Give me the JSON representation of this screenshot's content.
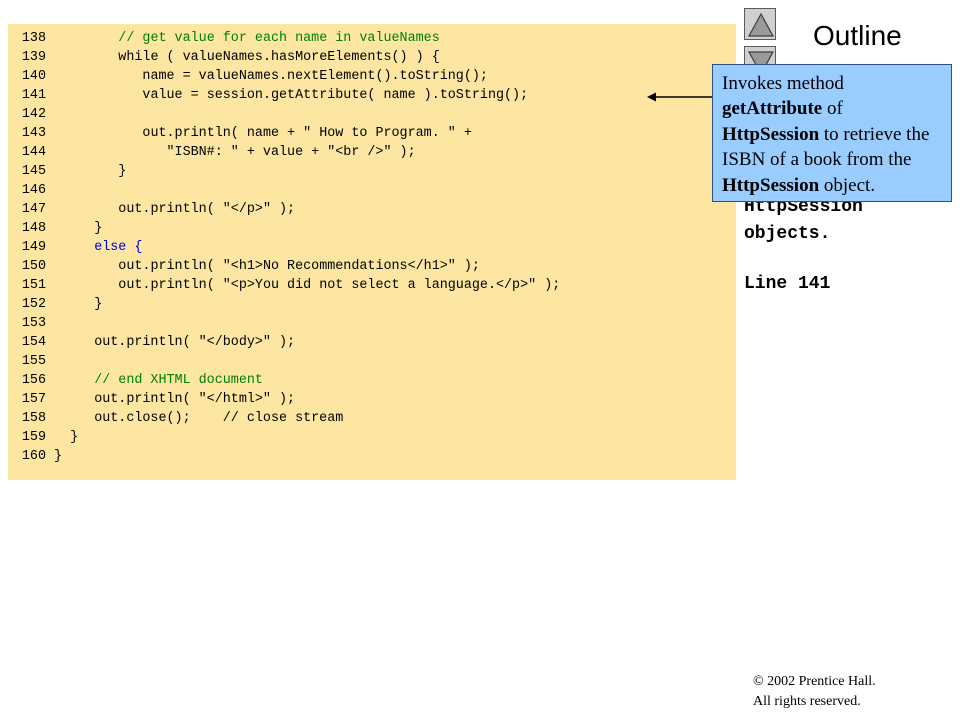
{
  "outline": {
    "title": "Outline",
    "nav_up": "up-arrow-icon",
    "nav_down": "down-arrow-icon"
  },
  "code": {
    "lines": [
      {
        "n": "138",
        "t": "// get value for each name in valueNames"
      },
      {
        "n": "139",
        "t": "while ( valueNames.hasMoreElements() ) {"
      },
      {
        "n": "140",
        "t": "name = valueNames.nextElement().toString();"
      },
      {
        "n": "141",
        "t": "value = session.getAttribute( name ).toString();"
      },
      {
        "n": "142",
        "t": ""
      },
      {
        "n": "143",
        "t": "out.println( name + \" How to Program. \" +"
      },
      {
        "n": "144",
        "t": "\"ISBN#: \" + value + \"<br />\" );"
      },
      {
        "n": "145",
        "t": "}"
      },
      {
        "n": "146",
        "t": ""
      },
      {
        "n": "147",
        "t": "out.println( \"</p>\" );"
      },
      {
        "n": "148",
        "t": "}"
      },
      {
        "n": "149",
        "t": "else {"
      },
      {
        "n": "150",
        "t": "out.println( \"<h1>No Recommendations</h1>\" );"
      },
      {
        "n": "151",
        "t": "out.println( \"<p>You did not select a language.</p>\" );"
      },
      {
        "n": "152",
        "t": "}"
      },
      {
        "n": "153",
        "t": ""
      },
      {
        "n": "154",
        "t": "out.println( \"</body>\" );"
      },
      {
        "n": "155",
        "t": ""
      },
      {
        "n": "156",
        "t": "// end XHTML document"
      },
      {
        "n": "157",
        "t": "out.println( \"</html>\" );"
      },
      {
        "n": "158",
        "t": "out.close();    // close stream"
      },
      {
        "n": "159",
        "t": "}"
      },
      {
        "n": "160",
        "t": "}"
      }
    ]
  },
  "sidebar": {
    "text1": "HttpSession",
    "text2": "objects.",
    "line_ref": "Line 141"
  },
  "callout": {
    "t1": "Invokes method",
    "t2": "getAttribute",
    "t3": " of",
    "t4": "HttpSession",
    "t5": " to retrieve the ISBN of a book from the ",
    "t6": "HttpSession",
    "t7": " object."
  },
  "footer": {
    "copyright_symbol": "©",
    "copyright_text": " 2002 Prentice Hall.",
    "rights": "All rights reserved."
  },
  "colors": {
    "code_background": "#FCE6A2",
    "keyword": "#0000CC",
    "comment": "#008000",
    "string": "#2F5FD0",
    "callout_background": "#99CCFF"
  }
}
